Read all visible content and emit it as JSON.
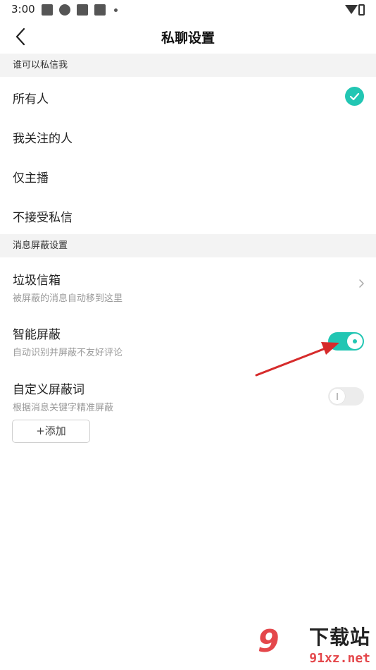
{
  "status_bar": {
    "time": "3:00",
    "icons": [
      "app-square-icon",
      "pinwheel-icon",
      "app-square-icon",
      "app-square-icon",
      "dot-icon",
      "wifi-icon",
      "battery-icon"
    ]
  },
  "nav": {
    "title": "私聊设置",
    "back_icon": "chevron-left-icon"
  },
  "who_can_message": {
    "header": "谁可以私信我",
    "options": [
      {
        "label": "所有人",
        "selected": true
      },
      {
        "label": "我关注的人",
        "selected": false
      },
      {
        "label": "仅主播",
        "selected": false
      },
      {
        "label": "不接受私信",
        "selected": false
      }
    ]
  },
  "block_settings": {
    "header": "消息屏蔽设置",
    "spam_box": {
      "title": "垃圾信箱",
      "subtitle": "被屏蔽的消息自动移到这里"
    },
    "smart_block": {
      "title": "智能屏蔽",
      "subtitle": "自动识别并屏蔽不友好评论",
      "enabled": true
    },
    "custom_words": {
      "title": "自定义屏蔽词",
      "subtitle": "根据消息关键字精准屏蔽",
      "enabled": false
    },
    "add_button": "+添加"
  },
  "colors": {
    "accent": "#22c6b3",
    "section_bg": "#f3f3f3",
    "annotation_arrow": "#d62b2b",
    "watermark_red": "#e4474b"
  },
  "watermark": {
    "logo": "9",
    "title": "下载站",
    "url": "91xz.net"
  }
}
